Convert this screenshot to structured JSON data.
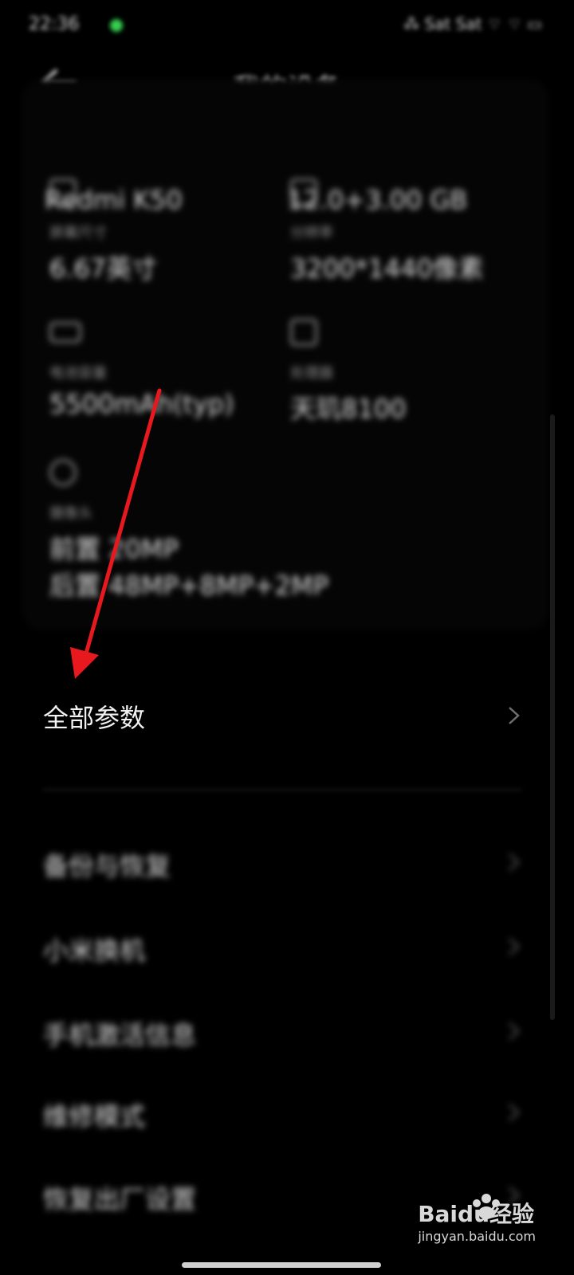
{
  "status_bar": {
    "time": "22:36",
    "right_text": "⁂ Sat Sat ⌔ ⌔ ▭"
  },
  "header": {
    "title": "我的设备"
  },
  "device": {
    "model_partial": "Redmi K50",
    "memory_partial": "12.0+3.00 GB",
    "screen_size": {
      "label": "屏幕尺寸",
      "value": "6.67英寸"
    },
    "resolution": {
      "label": "分辨率",
      "value": "3200*1440像素"
    },
    "battery": {
      "label": "电池容量",
      "value": "5500mAh(typ)"
    },
    "processor": {
      "label": "处理器",
      "value": "天玑8100"
    },
    "camera": {
      "label": "摄像头",
      "front": "前置 20MP",
      "rear": "后置 48MP+8MP+2MP"
    }
  },
  "all_params": {
    "label": "全部参数"
  },
  "menu": [
    {
      "label": "备份与恢复"
    },
    {
      "label": "小米换机"
    },
    {
      "label": "手机激活信息"
    },
    {
      "label": "维修模式"
    },
    {
      "label": "恢复出厂设置"
    }
  ],
  "watermark": {
    "brand": "Baidu经验",
    "url": "jingyan.baidu.com"
  },
  "colors": {
    "background": "#000000",
    "arrow": "#e8191e",
    "status_dot": "#35d04f"
  }
}
